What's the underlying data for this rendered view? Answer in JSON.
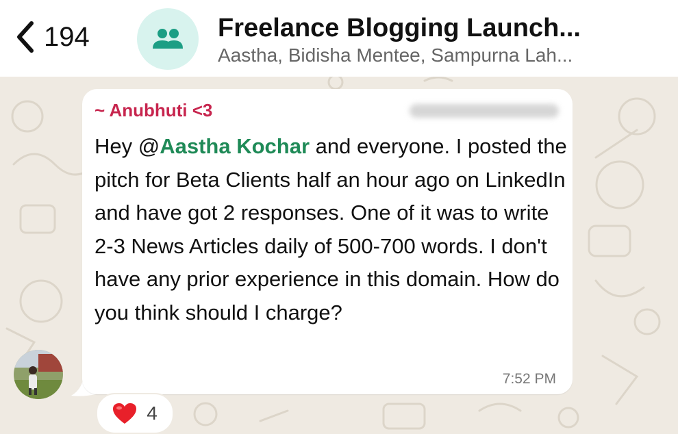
{
  "header": {
    "back_count": "194",
    "title": "Freelance Blogging Launch...",
    "subtitle": "Aastha, Bidisha Mentee, Sampurna Lah..."
  },
  "message": {
    "sender": "~ Anubhuti <3",
    "text_before_mention": "Hey @",
    "mention": "Aastha Kochar",
    "text_after_mention": " and everyone. I posted the pitch for Beta Clients half an hour ago on LinkedIn and have got 2 responses. One of it was to write 2-3 News Articles daily of 500-700 words. I don't have any prior experience in this domain. How do you think should I charge?",
    "time": "7:52 PM"
  },
  "reaction": {
    "icon": "heart-icon",
    "count": "4"
  },
  "colors": {
    "sender": "#c7254e",
    "mention": "#1f8a57",
    "background": "#efeae2",
    "group_avatar_bg": "#d8f3ee",
    "group_icon": "#1c9e84"
  }
}
